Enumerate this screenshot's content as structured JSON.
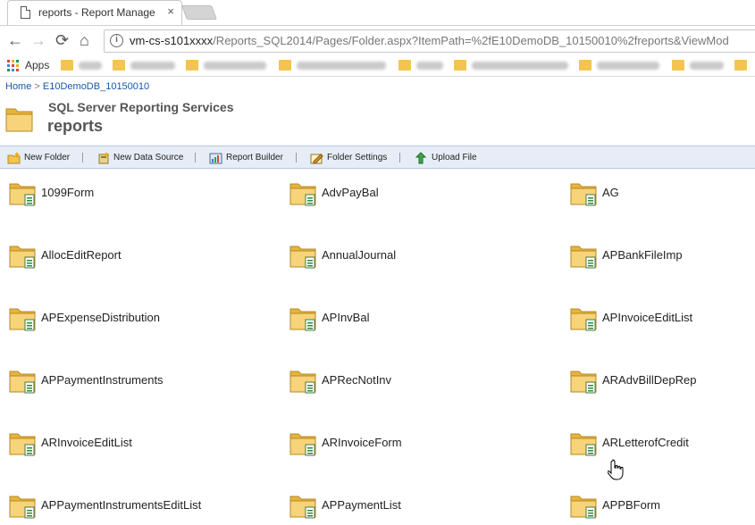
{
  "browser": {
    "tab_title": "reports - Report Manage",
    "tab_close": "×",
    "url_host": "vm-cs-s101xxxx",
    "url_path": "/Reports_SQL2014/Pages/Folder.aspx?ItemPath=%2fE10DemoDB_10150010%2freports&ViewMod",
    "info_glyph": "i",
    "nav": {
      "back": "←",
      "forward": "→",
      "reload": "⟳",
      "home": "⌂"
    },
    "bookmarks_apps_label": "Apps"
  },
  "breadcrumb": {
    "home": "Home",
    "separator": " > ",
    "current": "E10DemoDB_10150010"
  },
  "header": {
    "product": "SQL Server Reporting Services",
    "title": "reports"
  },
  "toolbar": {
    "new_folder": "New Folder",
    "new_data_source": "New Data Source",
    "report_builder": "Report Builder",
    "folder_settings": "Folder Settings",
    "upload_file": "Upload File"
  },
  "folders": [
    [
      "1099Form",
      "AdvPayBal",
      "AG"
    ],
    [
      "AllocEditReport",
      "AnnualJournal",
      "APBankFileImp"
    ],
    [
      "APExpenseDistribution",
      "APInvBal",
      "APInvoiceEditList"
    ],
    [
      "APPaymentInstruments",
      "APRecNotInv",
      "ARAdvBillDepRep"
    ],
    [
      "ARInvoiceEditList",
      "ARInvoiceForm",
      "ARLetterofCredit"
    ],
    [
      "APPaymentInstrumentsEditList",
      "APPaymentList",
      "APPBForm"
    ]
  ],
  "colors": {
    "link": "#1a57a5",
    "toolbar_bg": "#e7edf6",
    "folder": "#f3c451"
  }
}
